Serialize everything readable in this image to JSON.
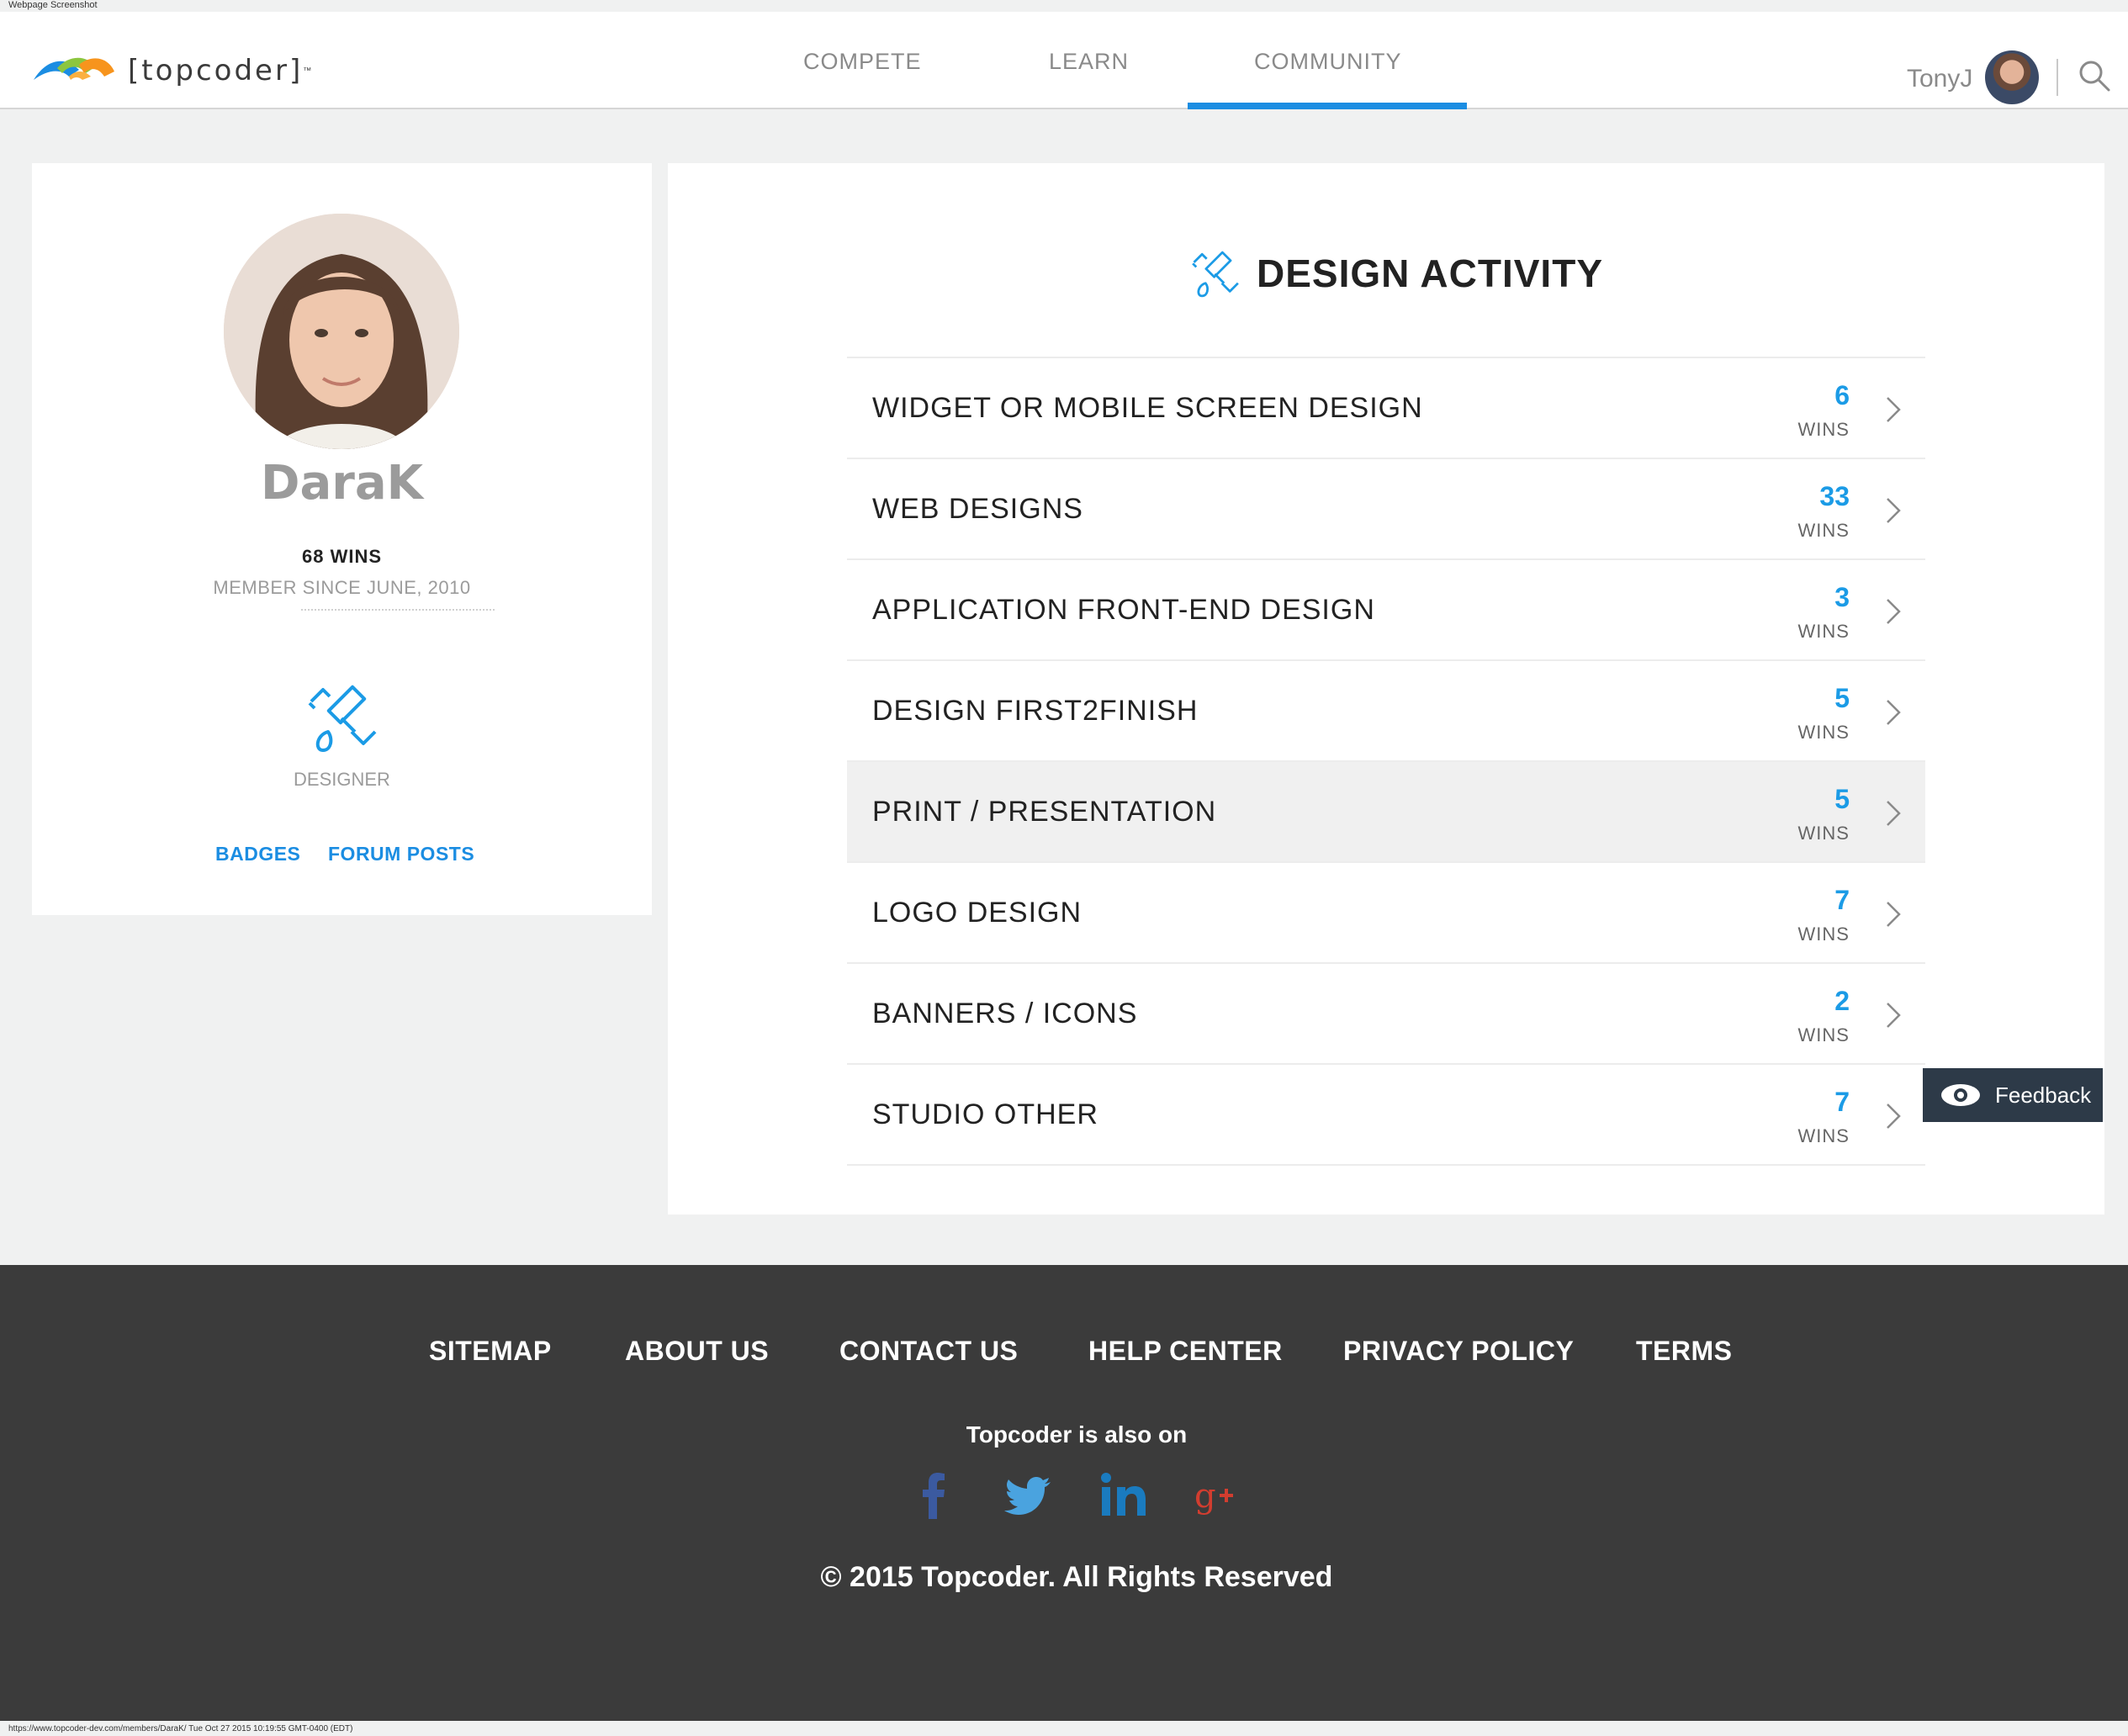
{
  "capture": {
    "label": "Webpage Screenshot",
    "url_line": "https://www.topcoder-dev.com/members/DaraK/ Tue Oct 27 2015 10:19:55 GMT-0400 (EDT)"
  },
  "header": {
    "logo_text": "[topcoder]",
    "logo_tm": "™",
    "nav": [
      {
        "label": "COMPETE"
      },
      {
        "label": "LEARN"
      },
      {
        "label": "COMMUNITY",
        "active": true
      }
    ],
    "user_name": "TonyJ",
    "accent_color": "#1b8de2"
  },
  "profile": {
    "handle": "DaraK",
    "wins": "68 WINS",
    "member_since": "MEMBER SINCE JUNE, 2010",
    "track_label": "DESIGNER",
    "links": {
      "badges": "BADGES",
      "forum_posts": "FORUM POSTS"
    }
  },
  "activity": {
    "title": "DESIGN ACTIVITY",
    "rows": [
      {
        "label": "WIDGET OR MOBILE SCREEN DESIGN",
        "count": "6",
        "wins_label": "WINS"
      },
      {
        "label": "WEB DESIGNS",
        "count": "33",
        "wins_label": "WINS"
      },
      {
        "label": "APPLICATION FRONT-END DESIGN",
        "count": "3",
        "wins_label": "WINS"
      },
      {
        "label": "DESIGN FIRST2FINISH",
        "count": "5",
        "wins_label": "WINS"
      },
      {
        "label": "PRINT / PRESENTATION",
        "count": "5",
        "wins_label": "WINS",
        "highlighted": true
      },
      {
        "label": "LOGO DESIGN",
        "count": "7",
        "wins_label": "WINS"
      },
      {
        "label": "BANNERS / ICONS",
        "count": "2",
        "wins_label": "WINS"
      },
      {
        "label": "STUDIO OTHER",
        "count": "7",
        "wins_label": "WINS"
      }
    ],
    "count_color": "#1b9be6"
  },
  "feedback": {
    "label": "Feedback"
  },
  "footer": {
    "links": [
      "SITEMAP",
      "ABOUT US",
      "CONTACT US",
      "HELP CENTER",
      "PRIVACY POLICY",
      "TERMS"
    ],
    "also_on": "Topcoder is also on",
    "social": [
      "facebook-icon",
      "twitter-icon",
      "linkedin-icon",
      "google-plus-icon"
    ],
    "copyright": "© 2015 Topcoder. All Rights Reserved"
  }
}
